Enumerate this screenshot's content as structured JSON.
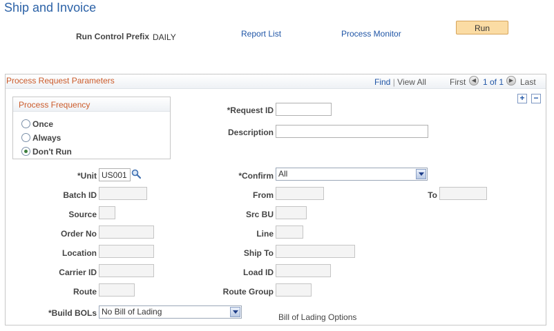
{
  "page": {
    "title": "Ship and Invoice"
  },
  "header": {
    "run_control_prefix_label": "Run Control Prefix",
    "run_control_prefix_value": "DAILY",
    "report_list": "Report List",
    "process_monitor": "Process Monitor",
    "run_button": "Run"
  },
  "panel": {
    "title": "Process Request Parameters",
    "find": "Find",
    "separator": "|",
    "view_all": "View All",
    "first": "First",
    "page_count": "1 of 1",
    "last": "Last",
    "add_icon": "+",
    "remove_icon": "−"
  },
  "frequency": {
    "title": "Process Frequency",
    "options": [
      "Once",
      "Always",
      "Don't Run"
    ],
    "selected": "Don't Run"
  },
  "fields": {
    "request_id": {
      "label": "*Request ID",
      "value": ""
    },
    "description": {
      "label": "Description",
      "value": ""
    },
    "unit": {
      "label": "*Unit",
      "value": "US001"
    },
    "confirm": {
      "label": "*Confirm",
      "value": "All"
    },
    "batch_id": {
      "label": "Batch ID",
      "value": ""
    },
    "from": {
      "label": "From",
      "value": ""
    },
    "to": {
      "label": "To",
      "value": ""
    },
    "source": {
      "label": "Source",
      "value": ""
    },
    "src_bu": {
      "label": "Src BU",
      "value": ""
    },
    "order_no": {
      "label": "Order No",
      "value": ""
    },
    "line": {
      "label": "Line",
      "value": ""
    },
    "location": {
      "label": "Location",
      "value": ""
    },
    "ship_to": {
      "label": "Ship To",
      "value": ""
    },
    "carrier_id": {
      "label": "Carrier ID",
      "value": ""
    },
    "load_id": {
      "label": "Load ID",
      "value": ""
    },
    "route": {
      "label": "Route",
      "value": ""
    },
    "route_group": {
      "label": "Route Group",
      "value": ""
    },
    "build_bols": {
      "label": "*Build BOLs",
      "value": "No Bill of Lading"
    }
  },
  "bill_of_lading_options": "Bill of Lading Options",
  "colors": {
    "title_blue": "#2c62a7",
    "section_orange": "#cb5b2a",
    "link_blue": "#1f55a6",
    "run_button_bg": "#fbdca4"
  }
}
